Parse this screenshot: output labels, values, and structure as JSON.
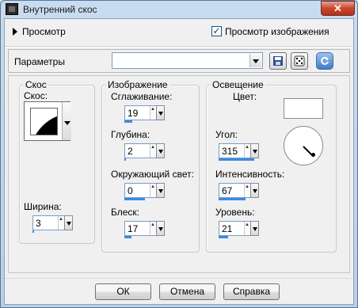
{
  "window": {
    "title": "Внутренний скос",
    "close_label": "✕"
  },
  "preview": {
    "label": "Просмотр",
    "image_preview_label": "Просмотр изображения",
    "image_preview_checked": true
  },
  "params": {
    "label": "Параметры",
    "value": ""
  },
  "bevel": {
    "group_title": "Скос",
    "shape_label": "Скос:",
    "width_label": "Ширина:",
    "width_value": "3",
    "width_fraction": 0.06
  },
  "image": {
    "group_title": "Изображение",
    "smoothing_label": "Сглаживание:",
    "smoothing_value": "19",
    "smoothing_fraction": 0.19,
    "depth_label": "Глубина:",
    "depth_value": "2",
    "depth_fraction": 0.03,
    "ambience_label": "Окружающий свет:",
    "ambience_value": "0",
    "ambience_fraction": 0.5,
    "shininess_label": "Блеск:",
    "shininess_value": "17",
    "shininess_fraction": 0.17
  },
  "lighting": {
    "group_title": "Освещение",
    "color_label": "Цвет:",
    "color": "#ffffff",
    "angle_label": "Угол:",
    "angle_value": "315",
    "angle_fraction": 0.875,
    "intensity_label": "Интенсивность:",
    "intensity_value": "67",
    "intensity_fraction": 0.67,
    "elevation_label": "Уровень:",
    "elevation_value": "21",
    "elevation_fraction": 0.23
  },
  "buttons": {
    "ok": "ОК",
    "cancel": "Отмена",
    "help": "Справка"
  },
  "icons": {
    "check": "✓",
    "updown": "▲▼"
  }
}
